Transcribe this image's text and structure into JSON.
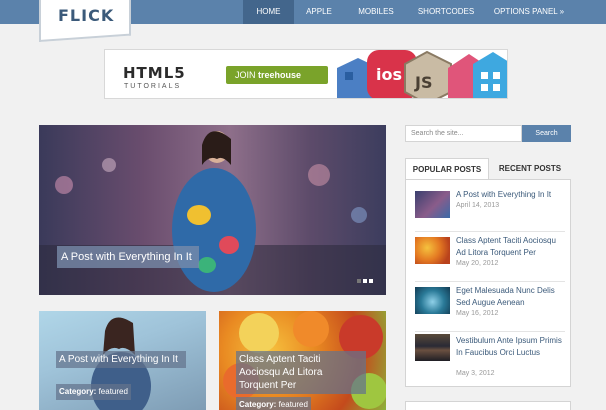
{
  "logo": {
    "text": "FLICK"
  },
  "nav": {
    "items": [
      {
        "label": "HOME",
        "active": true
      },
      {
        "label": "APPLE",
        "active": false
      },
      {
        "label": "MOBILES",
        "active": false
      },
      {
        "label": "SHORTCODES",
        "active": false
      },
      {
        "label": "OPTIONS PANEL »",
        "active": false
      }
    ]
  },
  "banner": {
    "title": "HTML5",
    "subtitle": "TUTORIALS",
    "cta_prefix": "JOIN",
    "cta_brand": "treehouse",
    "badges": [
      "ios",
      "JS"
    ]
  },
  "hero": {
    "caption": "A Post with Everything In It"
  },
  "cards": [
    {
      "title": "A Post with Everything In It",
      "category_label": "Category:",
      "category": "featured"
    },
    {
      "title": "Class Aptent Taciti Aociosqu Ad Litora Torquent Per",
      "category_label": "Category:",
      "category": "featured"
    }
  ],
  "sidebar": {
    "search_placeholder": "Search the site...",
    "search_button": "Search",
    "tabs": [
      "POPULAR POSTS",
      "RECENT POSTS"
    ],
    "posts": [
      {
        "title": "A Post with Everything In It",
        "date": "April 14, 2013"
      },
      {
        "title": "Class Aptent Taciti Aociosqu Ad Litora Torquent Per",
        "date": "May 20, 2012"
      },
      {
        "title": "Eget Malesuada Nunc Delis Sed Augue Aenean",
        "date": "May 16, 2012"
      },
      {
        "title": "Vestibulum Ante Ipsum Primis In Faucibus Orci Luctus",
        "date": "May 3, 2012"
      }
    ]
  },
  "colors": {
    "nav_bar": "#5b82ab",
    "nav_active": "#43668c",
    "link": "#3b5a7a",
    "cta_green": "#7aa32a"
  }
}
